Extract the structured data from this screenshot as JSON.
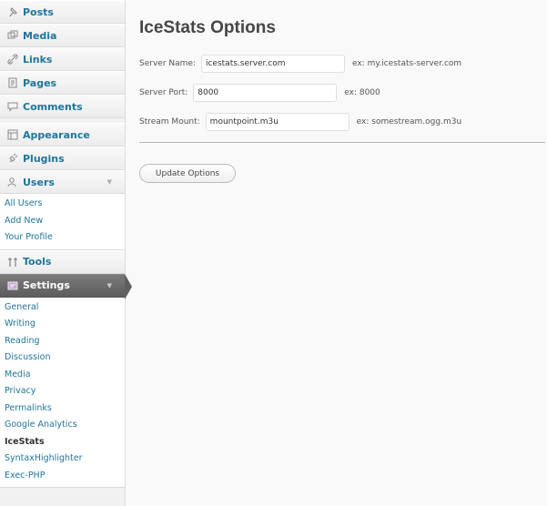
{
  "sidebar": {
    "posts": "Posts",
    "media": "Media",
    "links": "Links",
    "pages": "Pages",
    "comments": "Comments",
    "appearance": "Appearance",
    "plugins": "Plugins",
    "users": "Users",
    "users_sub": [
      "All Users",
      "Add New",
      "Your Profile"
    ],
    "tools": "Tools",
    "settings": "Settings",
    "settings_sub": [
      "General",
      "Writing",
      "Reading",
      "Discussion",
      "Media",
      "Privacy",
      "Permalinks",
      "Google Analytics",
      "IceStats",
      "SyntaxHighlighter",
      "Exec-PHP"
    ],
    "active_sub": "IceStats"
  },
  "main": {
    "title": "IceStats Options",
    "server_name": {
      "label": "Server Name:",
      "value": "icestats.server.com",
      "hint": "ex: my.icestats-server.com"
    },
    "server_port": {
      "label": "Server Port:",
      "value": "8000",
      "hint": "ex: 8000"
    },
    "stream_mount": {
      "label": "Stream Mount:",
      "value": "mountpoint.m3u",
      "hint": "ex: somestream.ogg.m3u"
    },
    "update_button": "Update Options"
  },
  "colors": {
    "link": "#21759b",
    "current_menu": "#5d5d5d",
    "background": "#f9f9f9"
  }
}
